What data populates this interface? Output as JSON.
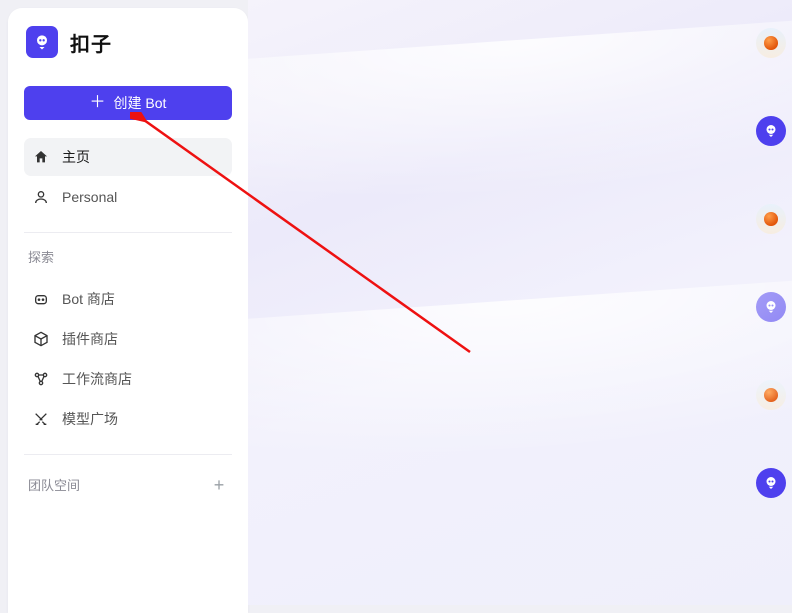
{
  "brand": {
    "name": "扣子"
  },
  "sidebar": {
    "create_label": "创建 Bot",
    "nav": [
      {
        "label": "主页"
      },
      {
        "label": "Personal"
      }
    ],
    "explore_title": "探索",
    "explore": [
      {
        "label": "Bot 商店"
      },
      {
        "label": "插件商店"
      },
      {
        "label": "工作流商店"
      },
      {
        "label": "模型广场"
      }
    ],
    "teamspace_title": "团队空间"
  },
  "right_rail": {
    "items": [
      {
        "kind": "balloon"
      },
      {
        "kind": "bot"
      },
      {
        "kind": "balloon"
      },
      {
        "kind": "bot"
      },
      {
        "kind": "balloon"
      },
      {
        "kind": "bot"
      }
    ]
  },
  "annotation": {
    "arrow_color": "#e11",
    "target": "create-bot-button"
  }
}
